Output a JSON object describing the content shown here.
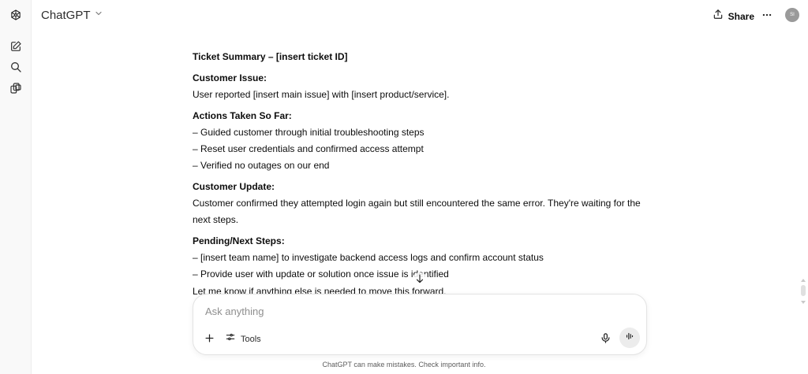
{
  "header": {
    "model_name": "ChatGPT",
    "share_label": "Share",
    "avatar_initials": "SI"
  },
  "sidebar": {
    "icons": [
      "openai-logo-icon",
      "new-chat-icon",
      "search-icon",
      "library-icon"
    ]
  },
  "message": {
    "title": "Ticket Summary – [insert ticket ID]",
    "customer_issue": {
      "heading": "Customer Issue:",
      "text": "User reported [insert main issue] with [insert product/service]."
    },
    "actions": {
      "heading": "Actions Taken So Far:",
      "items": [
        "– Guided customer through initial troubleshooting steps",
        "– Reset user credentials and confirmed access attempt",
        "– Verified no outages on our end"
      ]
    },
    "customer_update": {
      "heading": "Customer Update:",
      "text": "Customer confirmed they attempted login again but still encountered the same error. They're waiting for the next steps."
    },
    "next_steps": {
      "heading": "Pending/Next Steps:",
      "items": [
        "– [insert team name] to investigate backend access logs and confirm account status",
        "– Provide user with update or solution once issue is identified"
      ]
    },
    "closing": "Let me know if anything else is needed to move this forward."
  },
  "composer": {
    "placeholder": "Ask anything",
    "tools_label": "Tools"
  },
  "footer": {
    "disclaimer": "ChatGPT can make mistakes. Check important info."
  },
  "colors": {
    "sidebar_bg": "#f9f9f9",
    "text": "#0d0d0d",
    "muted": "#5d5d5d",
    "voice_button_bg": "#ececec"
  }
}
